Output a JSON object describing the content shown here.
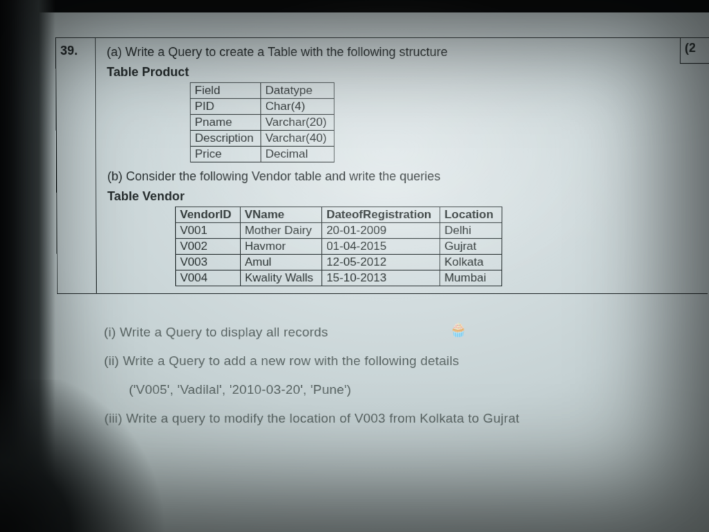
{
  "question_number": "39.",
  "marks_fragment": "(2",
  "part_a": {
    "text": "(a) Write a Query to create a Table with the following structure",
    "table_label": "Table Product",
    "columns": [
      "Field",
      "Datatype"
    ],
    "rows": [
      {
        "field": "PID",
        "datatype": "Char(4)"
      },
      {
        "field": "Pname",
        "datatype": "Varchar(20)"
      },
      {
        "field": "Description",
        "datatype": "Varchar(40)"
      },
      {
        "field": "Price",
        "datatype": "Decimal"
      }
    ]
  },
  "part_b": {
    "text": "(b) Consider the following Vendor table and write the queries",
    "table_label": "Table Vendor",
    "columns": [
      "VendorID",
      "VName",
      "DateofRegistration",
      "Location"
    ],
    "rows": [
      {
        "VendorID": "V001",
        "VName": "Mother Dairy",
        "DateofRegistration": "20-01-2009",
        "Location": "Delhi"
      },
      {
        "VendorID": "V002",
        "VName": "Havmor",
        "DateofRegistration": "01-04-2015",
        "Location": "Gujrat"
      },
      {
        "VendorID": "V003",
        "VName": "Amul",
        "DateofRegistration": "12-05-2012",
        "Location": "Kolkata"
      },
      {
        "VendorID": "V004",
        "VName": "Kwality Walls",
        "DateofRegistration": "15-10-2013",
        "Location": "Mumbai"
      }
    ]
  },
  "subquestions": {
    "i": "(i) Write a Query to display all records",
    "ii": "(ii) Write a Query to add a new row with the following details",
    "ii_detail": "('V005', 'Vadilal', '2010-03-20', 'Pune')",
    "iii": "(iii) Write a query to modify the location of V003 from Kolkata to Gujrat"
  }
}
